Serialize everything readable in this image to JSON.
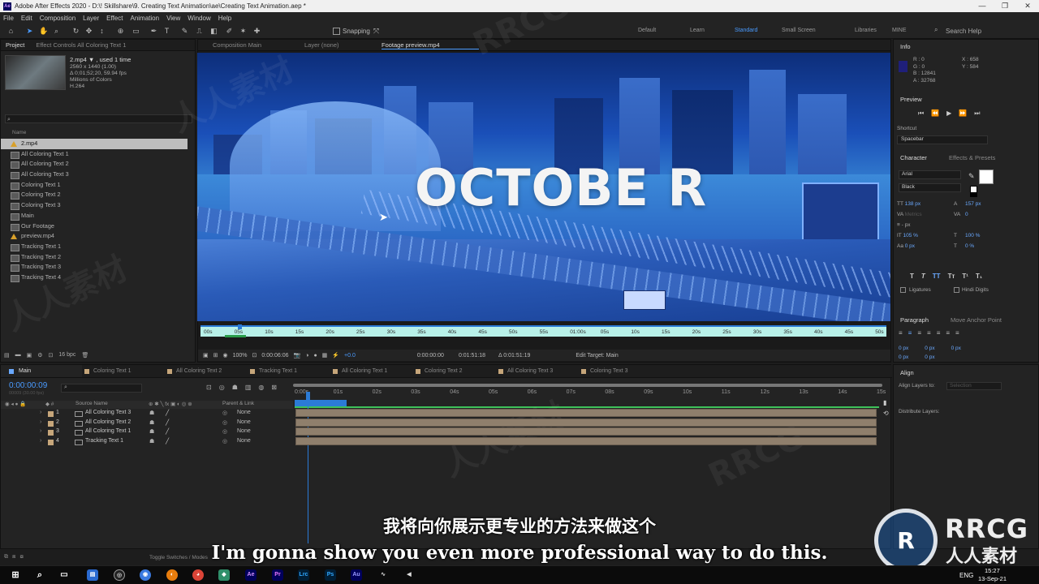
{
  "window": {
    "title": "Adobe After Effects 2020 - D:\\! Skillshare\\9. Creating Text Animation\\ae\\Creating Text Animation.aep *"
  },
  "menu": [
    "File",
    "Edit",
    "Composition",
    "Layer",
    "Effect",
    "Animation",
    "View",
    "Window",
    "Help"
  ],
  "toolbar": {
    "snapping": "Snapping",
    "workspaces": [
      "Default",
      "Learn",
      "Standard",
      "Small Screen",
      "Libraries",
      "MINE"
    ],
    "active_workspace": "Standard",
    "search_placeholder": "Search Help"
  },
  "project": {
    "tab": "Project",
    "effect_tab": "Effect Controls All Coloring Text 1",
    "selected_name": "2.mp4 ▼ , used 1 time",
    "info": [
      "2560 x 1440 (1.00)",
      "Δ 0;01;52;20, 59.94 fps",
      "Millions of Colors",
      "H.264"
    ],
    "column_header": "Name",
    "items": [
      "2.mp4",
      "All Coloring Text 1",
      "All Coloring Text 2",
      "All Coloring Text 3",
      "Coloring Text 1",
      "Coloring Text 2",
      "Coloring Text 3",
      "Main",
      "Our Footage",
      "preview.mp4",
      "Tracking Text 1",
      "Tracking Text 2",
      "Tracking Text 3",
      "Tracking Text 4"
    ],
    "bpc": "16 bpc"
  },
  "viewer": {
    "tabs": [
      "Composition Main",
      "Layer (none)",
      "Footage preview.mp4"
    ],
    "overlay_text": "OCTOBE R",
    "ruler_labels": [
      "00s",
      "05s",
      "10s",
      "15s",
      "20s",
      "25s",
      "30s",
      "35s",
      "40s",
      "45s",
      "50s",
      "55s",
      "01:00s",
      "05s",
      "10s",
      "15s",
      "20s",
      "25s",
      "30s",
      "35s",
      "40s",
      "45s",
      "50s"
    ],
    "zoom": "100%",
    "timecode": "0:00:06:06",
    "in_point": "0:00:00:00",
    "out_point": "0:01:51:18",
    "duration": "Δ 0:01:51:19",
    "edit_target": "Edit Target: Main",
    "exposure": "+0.0"
  },
  "info_panel": {
    "title": "Info",
    "r": "R : 0",
    "g": "G : 0",
    "b": "B : 12841",
    "a": "A : 32768",
    "x": "X : 658",
    "y": "Y : 584"
  },
  "preview": {
    "title": "Preview",
    "shortcut_label": "Shortcut",
    "shortcut_value": "Spacebar"
  },
  "character": {
    "title": "Character",
    "effects_tab": "Effects & Presets",
    "font": "Arial",
    "style": "Black",
    "size": "138 px",
    "leading": "157 px",
    "kerning": "Metrics",
    "tracking": "0",
    "stroke": "- px",
    "vscale": "105 %",
    "hscale": "100 %",
    "baseline": "0 px",
    "tsume": "0 %",
    "ligatures": "Ligatures",
    "hindi": "Hindi Digits"
  },
  "paragraph": {
    "title": "Paragraph",
    "anchor_tab": "Move Anchor Point",
    "fields": [
      "0 px",
      "0 px",
      "0 px",
      "0 px",
      "0 px"
    ]
  },
  "align": {
    "title": "Align",
    "align_to": "Align Layers to:",
    "align_to_value": "Selection",
    "distribute": "Distribute Layers:"
  },
  "timeline": {
    "tabs": [
      "Main",
      "Coloring Text 1",
      "All Coloring Text 2",
      "Tracking Text 1",
      "All Coloring Text 1",
      "Coloring Text 2",
      "All Coloring Text 3",
      "Coloring Text 3"
    ],
    "timecode": "0:00:00:09",
    "fps": "00009 (30.00 fps)",
    "col_source": "Source Name",
    "col_parent": "Parent & Link",
    "ruler": [
      "0:00s",
      "01s",
      "02s",
      "03s",
      "04s",
      "05s",
      "06s",
      "07s",
      "08s",
      "09s",
      "10s",
      "11s",
      "12s",
      "13s",
      "14s",
      "15s"
    ],
    "layers": [
      {
        "num": "1",
        "name": "All Coloring Text 3",
        "parent": "None"
      },
      {
        "num": "2",
        "name": "All Coloring Text 2",
        "parent": "None"
      },
      {
        "num": "3",
        "name": "All Coloring Text 1",
        "parent": "None"
      },
      {
        "num": "4",
        "name": "Tracking Text 1",
        "parent": "None"
      }
    ],
    "toggle": "Toggle Switches / Modes"
  },
  "subtitles": {
    "cn": "我将向你展示更专业的方法来做这个",
    "en": "I'm gonna show you even more professional way to do this."
  },
  "watermark": {
    "brand": "RRCG",
    "cn": "人人素材"
  },
  "taskbar": {
    "lang": "ENG",
    "time": "15:27",
    "date": "13-Sep-21",
    "apps": [
      "Ae",
      "Pr",
      "Lrc",
      "Ps",
      "Au"
    ]
  }
}
